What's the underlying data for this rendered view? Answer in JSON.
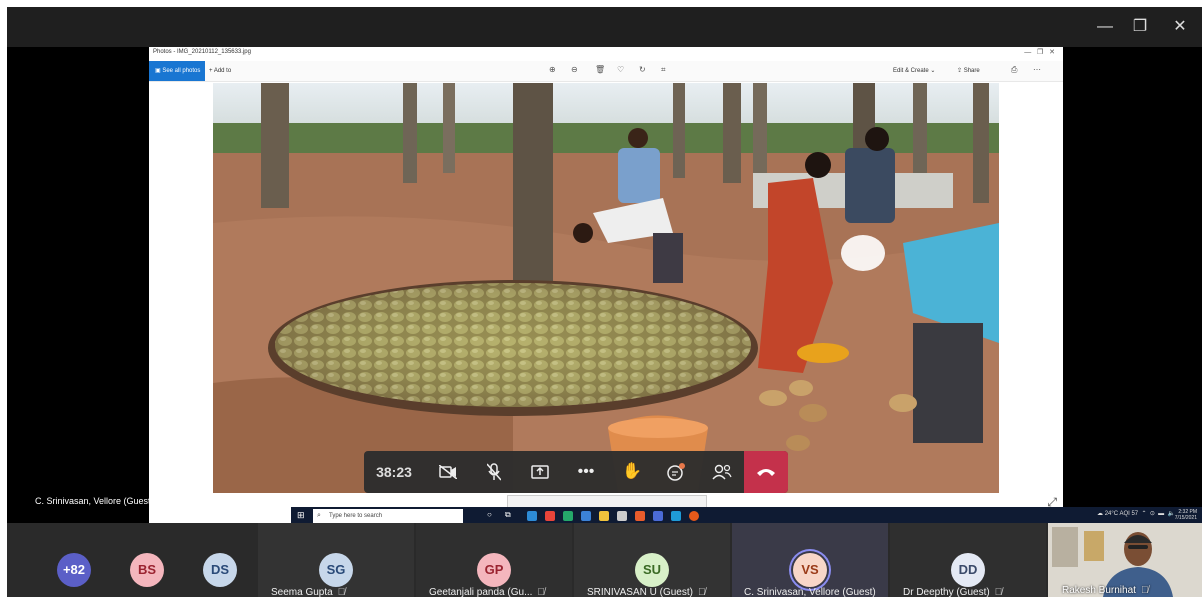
{
  "photos_app": {
    "title": "Photos - IMG_20210112_135633.jpg",
    "see_all_photos": "See all photos",
    "add_to": "Add to",
    "edit_create": "Edit & Create",
    "share": "Share"
  },
  "presenter": {
    "label": "C. Srinivasan, Vellore (Guest)"
  },
  "taskbar": {
    "search_placeholder": "Type here to search",
    "weather": "24°C AQI 57",
    "time": "2:32 PM",
    "date": "7/15/2021"
  },
  "controls": {
    "timer": "38:23"
  },
  "participants": {
    "overflow": {
      "label": "+82",
      "color": "#5b5fc7"
    },
    "avatars_only": [
      {
        "initials": "BS",
        "bg": "#f4b6bd"
      },
      {
        "initials": "DS",
        "bg": "#c7d7ea"
      }
    ],
    "tiles": [
      {
        "initials": "SG",
        "name": "Seema Gupta",
        "bg": "#c7d7ea"
      },
      {
        "initials": "GP",
        "name": "Geetanjali panda (Gu...",
        "bg": "#f4b6bd"
      },
      {
        "initials": "SU",
        "name": "SRINIVASAN U (Guest)",
        "bg": "#d8f0c8"
      },
      {
        "initials": "VS",
        "name": "C. Srinivasan, Vellore (Guest)",
        "bg": "#f8d6c8"
      },
      {
        "initials": "DD",
        "name": "Dr Deepthy (Guest)",
        "bg": "#e4e9f4"
      }
    ],
    "video": {
      "name": "Rakesh Burnihat"
    }
  }
}
